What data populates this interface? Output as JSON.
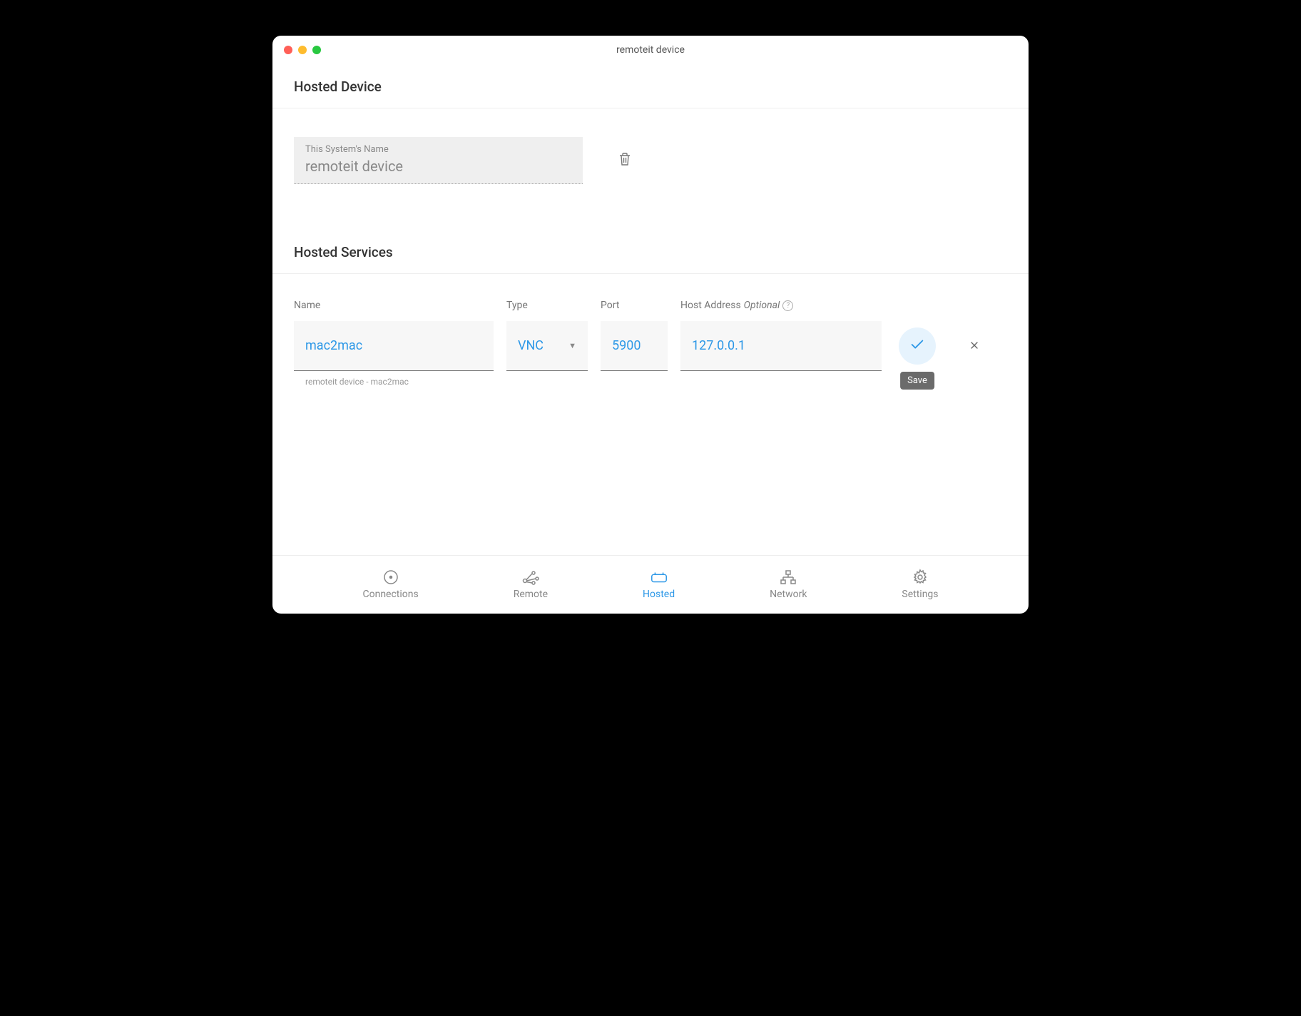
{
  "window": {
    "title": "remoteit device"
  },
  "hosted_device": {
    "section_title": "Hosted Device",
    "name_label": "This System's Name",
    "name_value": "remoteit device"
  },
  "hosted_services": {
    "section_title": "Hosted Services",
    "columns": {
      "name": "Name",
      "type": "Type",
      "port": "Port",
      "host": "Host Address",
      "host_optional": "Optional"
    },
    "row": {
      "name": "mac2mac",
      "type": "VNC",
      "port": "5900",
      "host": "127.0.0.1",
      "helper": "remoteit device - mac2mac"
    },
    "save_tooltip": "Save"
  },
  "nav": {
    "connections": "Connections",
    "remote": "Remote",
    "hosted": "Hosted",
    "network": "Network",
    "settings": "Settings"
  }
}
